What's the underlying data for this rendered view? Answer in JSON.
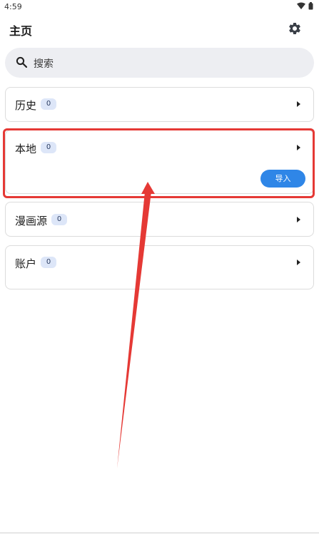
{
  "status": {
    "time": "4:59"
  },
  "header": {
    "title": "主页",
    "settings_icon": "gear-icon"
  },
  "search": {
    "placeholder": "搜索",
    "icon": "search-icon"
  },
  "cards": {
    "history": {
      "title": "历史",
      "count": "0"
    },
    "local": {
      "title": "本地",
      "count": "0",
      "import_label": "导入"
    },
    "sources": {
      "title": "漫画源",
      "count": "0"
    },
    "account": {
      "title": "账户",
      "count": "0"
    }
  },
  "colors": {
    "accent": "#2f86e7",
    "badge_bg": "#dde6f8",
    "search_bg": "#edeef2",
    "annotation": "#e53935"
  }
}
